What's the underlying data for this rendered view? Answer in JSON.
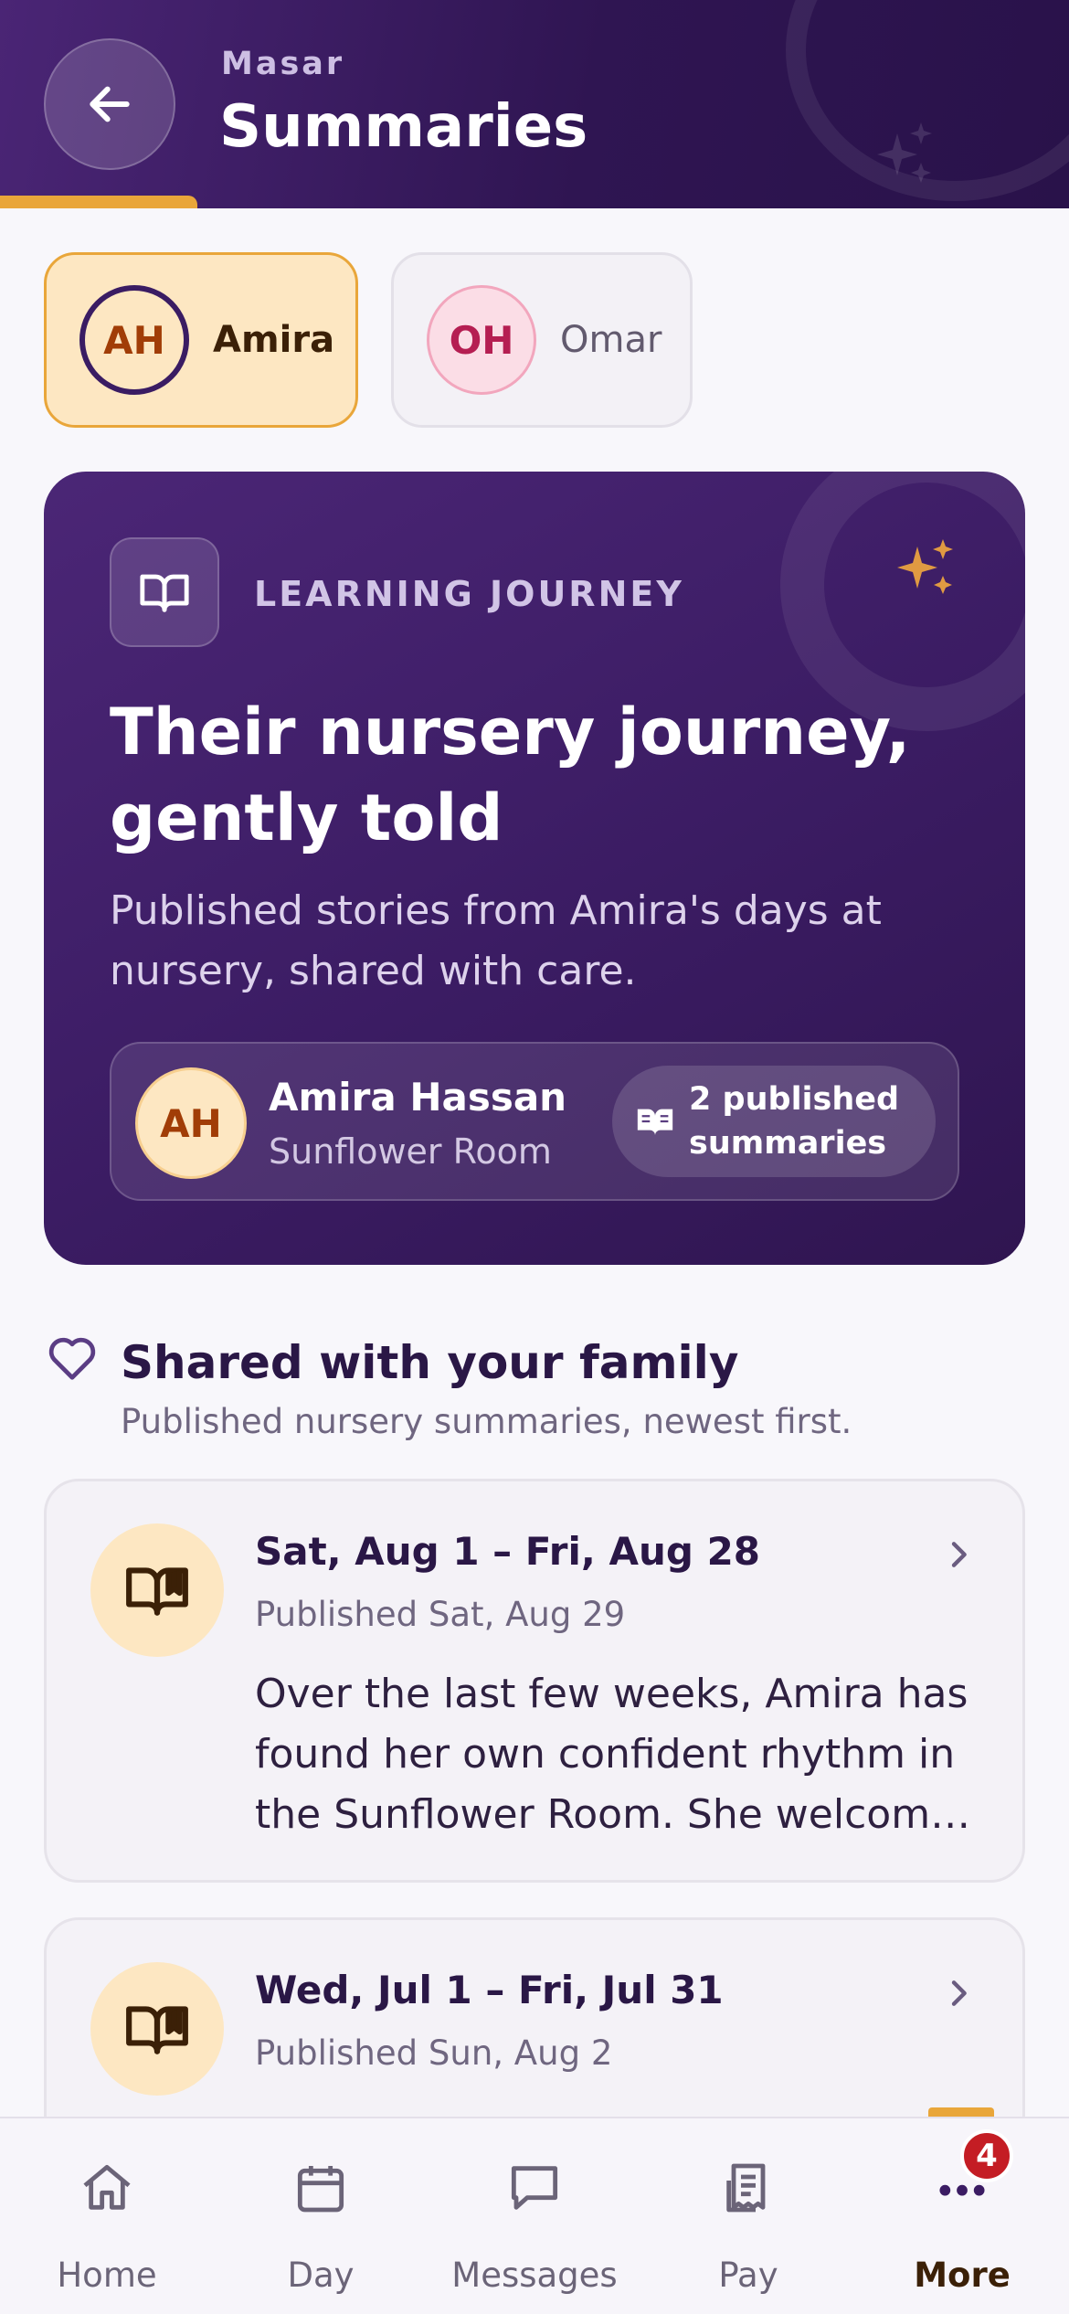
{
  "header": {
    "overline": "Masar",
    "title": "Summaries"
  },
  "children": [
    {
      "initials": "AH",
      "name": "Amira",
      "selected": true
    },
    {
      "initials": "OH",
      "name": "Omar",
      "selected": false
    }
  ],
  "hero": {
    "overline": "LEARNING JOURNEY",
    "title": "Their nursery journey, gently told",
    "subtitle": "Published stories from Amira's days at nursery, shared with care.",
    "profile": {
      "initials": "AH",
      "name": "Amira Hassan",
      "room": "Sunflower Room",
      "badge_line1": "2 published",
      "badge_line2": "summaries"
    }
  },
  "section": {
    "title": "Shared with your family",
    "subtitle": "Published nursery summaries, newest first."
  },
  "summaries": [
    {
      "title": "Sat, Aug 1 – Fri, Aug 28",
      "published": "Published Sat, Aug 29",
      "excerpt": "Over the last few weeks, Amira has found her own confident rhythm in the Sunflower Room. She welcomes each morning with a smile and settles quickly into play with her friends."
    },
    {
      "title": "Wed, Jul 1 – Fri, Jul 31",
      "published": "Published Sun, Aug 2",
      "excerpt": ""
    }
  ],
  "nav": {
    "items": [
      {
        "label": "Home",
        "icon": "home-icon"
      },
      {
        "label": "Day",
        "icon": "calendar-icon"
      },
      {
        "label": "Messages",
        "icon": "message-icon"
      },
      {
        "label": "Pay",
        "icon": "receipt-icon"
      },
      {
        "label": "More",
        "icon": "more-icon",
        "active": true
      }
    ],
    "more_badge": "4"
  },
  "colors": {
    "primary": "#3b1c63",
    "accent": "#e9a63a",
    "badge": "#c41d24"
  }
}
